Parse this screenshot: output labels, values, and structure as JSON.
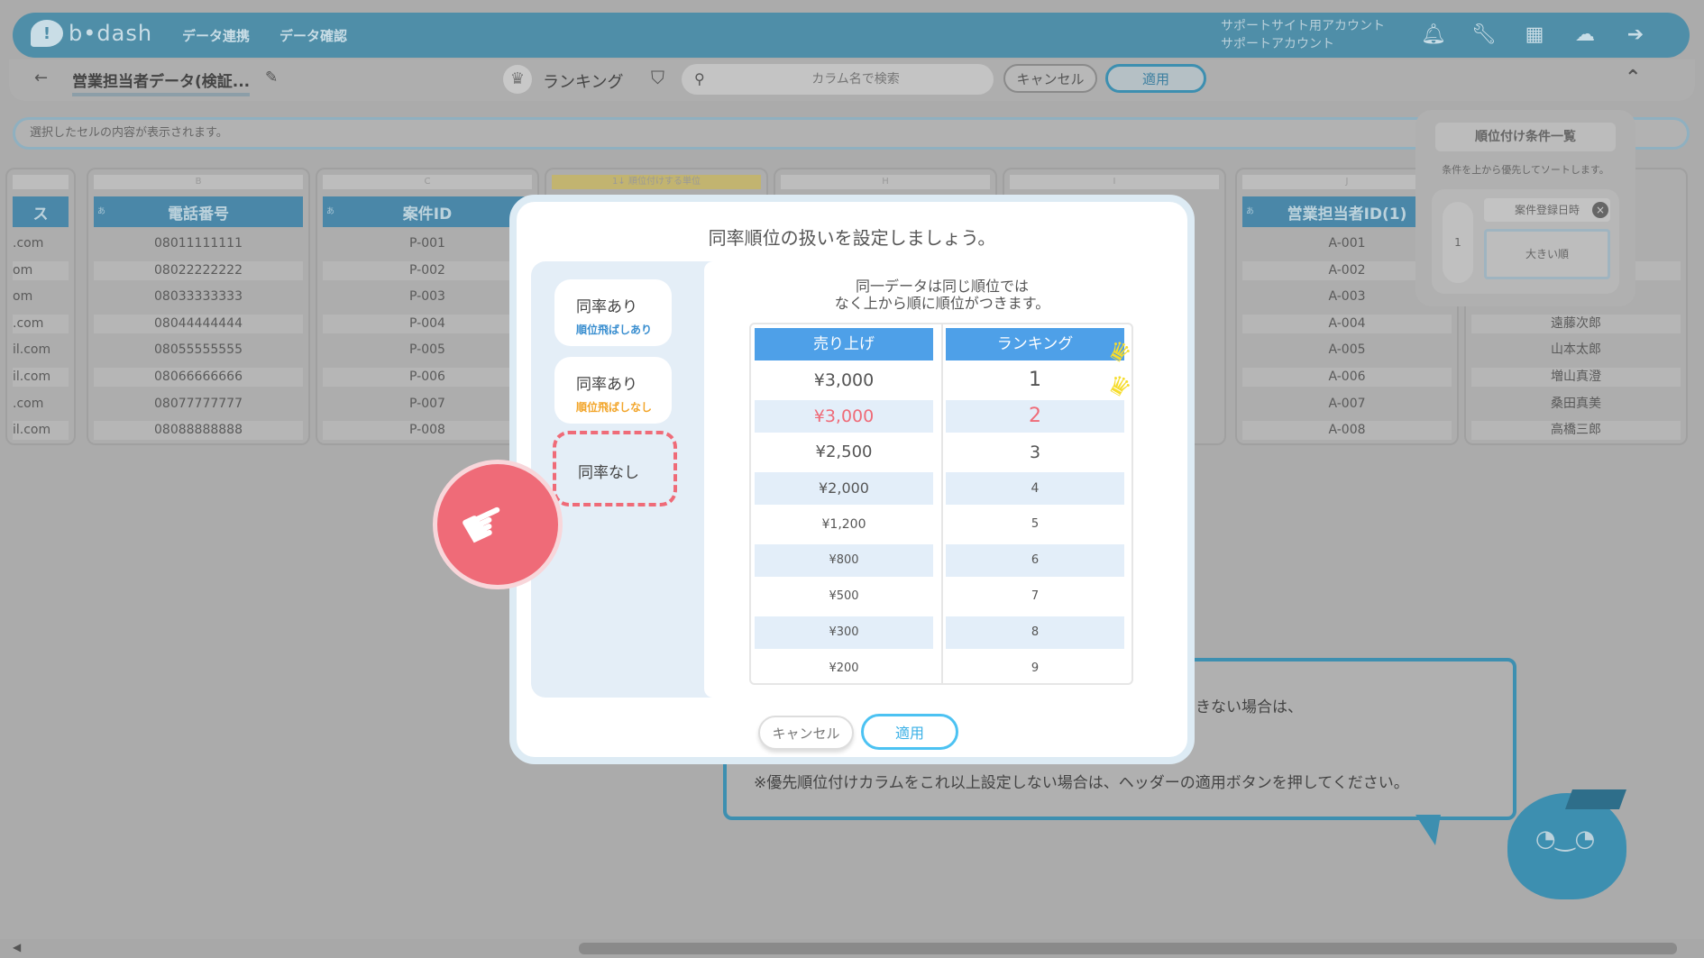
{
  "header": {
    "brand": "b•dash",
    "nav": [
      "データ連携",
      "データ確認"
    ],
    "account_line1": "サポートサイト用アカウント",
    "account_line2": "サポートアカウント",
    "icons": [
      "bell-icon",
      "wrench-icon",
      "grid-icon",
      "brain-icon",
      "logout-icon"
    ]
  },
  "toolbar": {
    "sheet_title": "営業担当者データ(検証...",
    "mode_label": "ランキング",
    "search_placeholder": "カラム名で検索",
    "cancel_label": "キャンセル",
    "apply_label": "適用"
  },
  "cell_bar": {
    "placeholder": "選択したセルの内容が表示されます。"
  },
  "columns": [
    {
      "letter": "",
      "type": "",
      "name": "ス",
      "cells": [
        ".com",
        "om",
        "om",
        ".com",
        "il.com",
        "il.com",
        ".com",
        "il.com"
      ]
    },
    {
      "letter": "B",
      "type": "あ",
      "name": "電話番号",
      "cells": [
        "08011111111",
        "08022222222",
        "08033333333",
        "08044444444",
        "08055555555",
        "08066666666",
        "08077777777",
        "08088888888"
      ]
    },
    {
      "letter": "C",
      "type": "あ",
      "name": "案件ID",
      "cells": [
        "P-001",
        "P-002",
        "P-003",
        "P-004",
        "P-005",
        "P-006",
        "P-007",
        "P-008"
      ]
    },
    {
      "letter": "1↓",
      "type": "",
      "name": "",
      "cells": []
    },
    {
      "letter": "H",
      "type": "",
      "name": "",
      "cells": []
    },
    {
      "letter": "I",
      "type": "",
      "name": "",
      "cells": []
    },
    {
      "letter": "J",
      "type": "あ",
      "name": "営業担当者ID(1)",
      "cells": [
        "A-001",
        "A-002",
        "A-003",
        "A-004",
        "A-005",
        "A-006",
        "A-007",
        "A-008"
      ]
    },
    {
      "letter": "",
      "type": "",
      "name": "",
      "cells": [
        "",
        "",
        "",
        "遠藤次郎",
        "山本太郎",
        "増山真澄",
        "桑田真美",
        "高橋三郎"
      ]
    }
  ],
  "rank_unit_label": "順位付けする単位",
  "rank_panel": {
    "title": "順位付け条件一覧",
    "desc": "条件を上から優先してソートします。",
    "number": "1",
    "field": "案件登録日時",
    "order": "大きい順"
  },
  "tutorial": {
    "line1": "きない場合は、",
    "line2": "※優先順位付けカラムをこれ以上設定しない場合は、ヘッダーの適用ボタンを押してください。"
  },
  "modal": {
    "title": "同率順位の扱いを設定しましょう。",
    "options": [
      {
        "label": "同率あり",
        "sub": "順位飛ばしあり"
      },
      {
        "label": "同率あり",
        "sub": "順位飛ばしなし"
      },
      {
        "label": "同率なし",
        "sub": ""
      }
    ],
    "desc_line1": "同一データは同じ順位では",
    "desc_line2": "なく上から順に順位がつきます。",
    "table": {
      "col1": "売り上げ",
      "col2": "ランキング",
      "sales": [
        "¥3,000",
        "¥3,000",
        "¥2,500",
        "¥2,000",
        "¥1,200",
        "¥800",
        "¥500",
        "¥300",
        "¥200"
      ],
      "ranks": [
        "1",
        "2",
        "3",
        "4",
        "5",
        "6",
        "7",
        "8",
        "9"
      ]
    },
    "cancel_label": "キャンセル",
    "apply_label": "適用"
  },
  "colors": {
    "primary": "#4ea0e8",
    "accent_red": "#ef6b78",
    "accent_orange": "#f2a52a",
    "header_blue": "#4f8ea8"
  }
}
